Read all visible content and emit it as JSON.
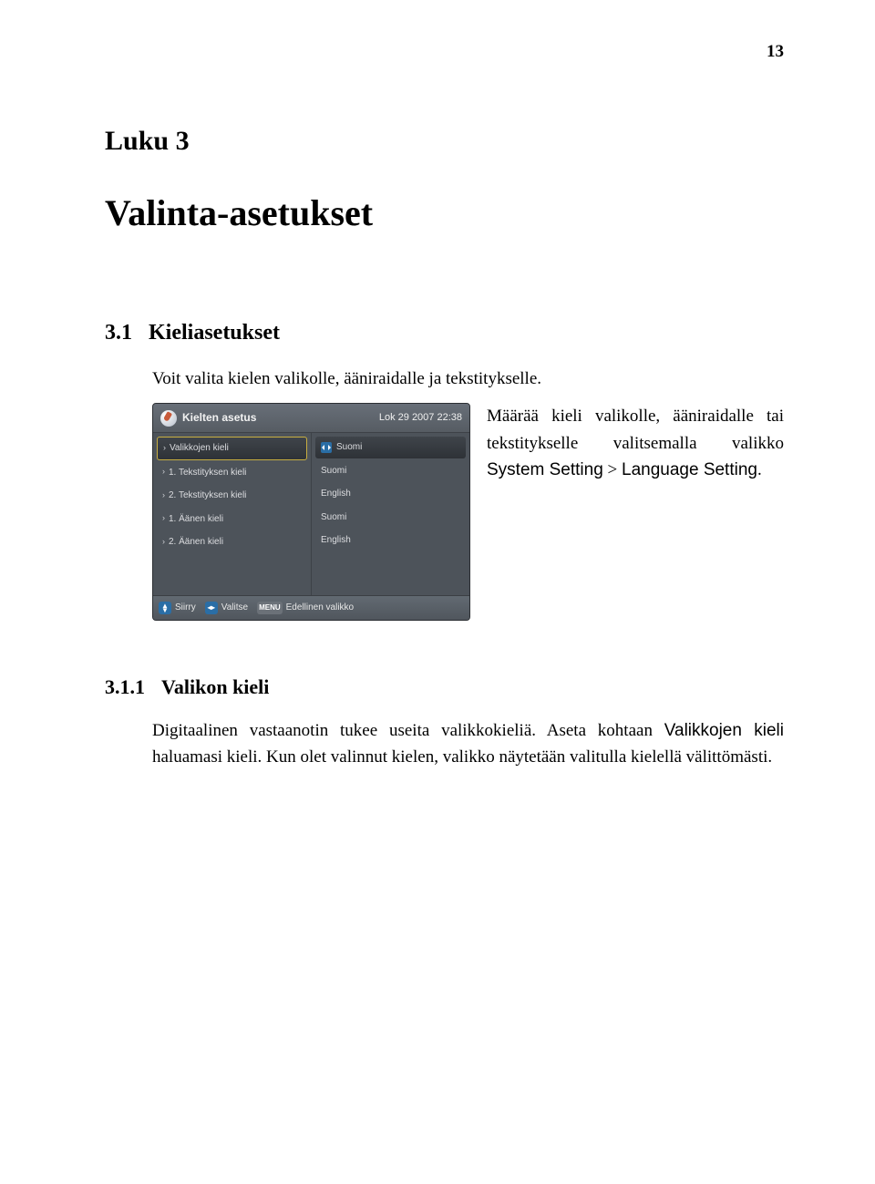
{
  "page_number": "13",
  "chapter_label": "Luku 3",
  "chapter_title": "Valinta-asetukset",
  "section": {
    "number": "3.1",
    "title": "Kieliasetukset",
    "intro": "Voit valita kielen valikolle, ääniraidalle ja tekstitykselle.",
    "side_text_1": "Määrää kieli valikolle, ääniraidalle tai tekstitykselle valitsemalla valikko ",
    "side_text_menu1": "System Setting",
    "side_text_gt": " > ",
    "side_text_menu2": "Language Setting",
    "side_text_end": "."
  },
  "subsection": {
    "number": "3.1.1",
    "title": "Valikon kieli",
    "body_1": "Digitaalinen vastaanotin tukee useita valikkokieliä. Aseta kohtaan ",
    "body_menu": "Valikkojen kieli",
    "body_2": " haluamasi kieli. Kun olet valinnut kielen, valikko näytetään valitulla kielellä välittömästi."
  },
  "screenshot": {
    "title": "Kielten asetus",
    "datetime": "Lok 29 2007 22:38",
    "left": [
      {
        "label": "Valikkojen kieli",
        "selected": true
      },
      {
        "label": "1. Tekstityksen kieli"
      },
      {
        "label": "2. Tekstityksen kieli"
      },
      {
        "label": "1. Äänen kieli"
      },
      {
        "label": "2. Äänen kieli"
      }
    ],
    "right": [
      {
        "label": "Suomi",
        "selected": true
      },
      {
        "label": "Suomi"
      },
      {
        "label": "English"
      },
      {
        "label": "Suomi"
      },
      {
        "label": "English"
      }
    ],
    "footer": {
      "siirry": "Siirry",
      "valitse": "Valitse",
      "menu_key": "MENU",
      "edellinen": "Edellinen valikko"
    }
  }
}
